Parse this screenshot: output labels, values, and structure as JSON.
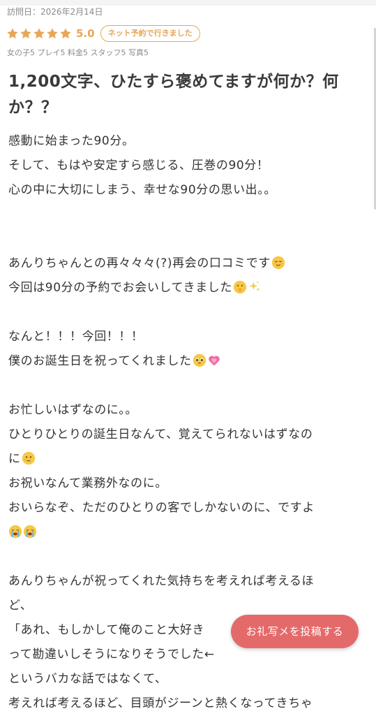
{
  "visit_date": "訪問日：2026年2月14日",
  "rating": {
    "stars": 5,
    "score": "5.0",
    "star_color": "#e8a657",
    "reserve_badge": "ネット予約で行きました"
  },
  "sub_scores": "女の子5 プレイ5 料金5 スタッフ5 写真5",
  "title": "1,200文字、ひたすら褒めてますが何か？何か？？",
  "body": {
    "l1": "感動に始まった90分。",
    "l2": "そして、もはや安定すら感じる、圧巻の90分！",
    "l3": "心の中に大切にしまう、幸せな90分の思い出。。",
    "l4": "あんりちゃんとの再々々々(?)再会の口コミです",
    "l5": "今回は90分の予約でお会いしてきました",
    "l6": "なんと！！！今回！！！",
    "l7": "僕のお誕生日を祝ってくれました",
    "l8": "お忙しいはずなのに。。",
    "l9": "ひとりひとりの誕生日なんて、覚えてられないはずなの",
    "l10": "に",
    "l11": "お祝いなんて業務外なのに。",
    "l12": "おいらなぞ、ただのひとりの客でしかないのに、ですよ",
    "l13": "",
    "l14": "あんりちゃんが祝ってくれた気持ちを考えれば考えるほ",
    "l15": "ど、",
    "l16": "「あれ、もしかして俺のこと大好き",
    "l17": "って勘違いしそうになりそうでした←",
    "l18": "というバカな話ではなくて、",
    "l19": "考えれば考えるほど、目頭がジーンと熱くなってきちゃ"
  },
  "emoji_icons": {
    "relieved": "relieved-face-icon",
    "shush": "shushing-face-icon",
    "sparkles": "sparkles-icon",
    "pleading": "pleading-face-icon",
    "heart": "growing-heart-icon",
    "tear": "face-holding-back-tears-icon",
    "sob": "loudly-crying-face-icon"
  },
  "post_button": "お礼写メを投稿する",
  "colors": {
    "accent": "#e8a657",
    "button": "#e46a6a",
    "text": "#333333",
    "muted": "#8a8a8a"
  }
}
